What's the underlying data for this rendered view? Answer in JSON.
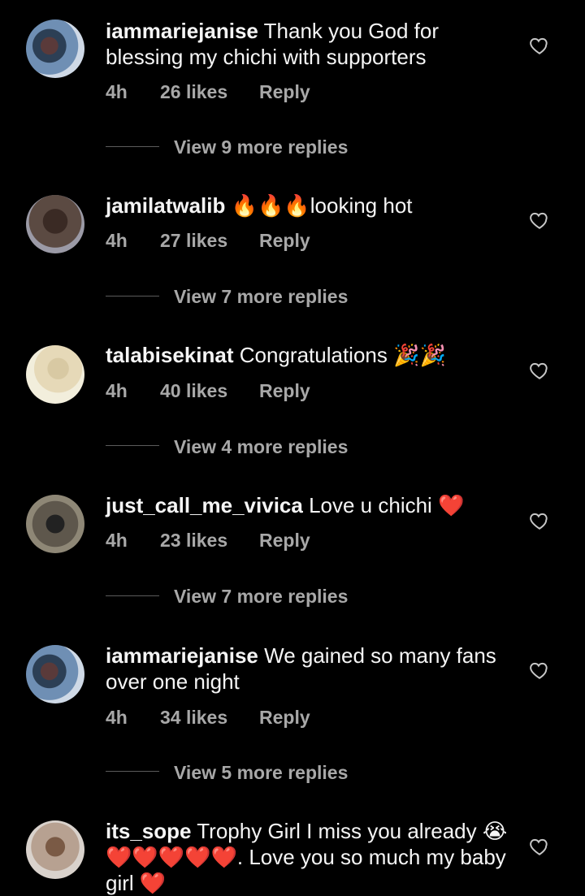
{
  "comments": [
    {
      "username": "iammariejanise",
      "text": "Thank you God for blessing my chichi with supporters",
      "time": "4h",
      "likes": "26 likes",
      "reply": "Reply",
      "more_replies": "View 9 more replies",
      "avatar_icon": "user-avatar"
    },
    {
      "username": "jamilatwalib",
      "text": "🔥🔥🔥looking hot",
      "time": "4h",
      "likes": "27 likes",
      "reply": "Reply",
      "more_replies": "View 7 more replies",
      "avatar_icon": "user-avatar"
    },
    {
      "username": "talabisekinat",
      "text": "Congratulations 🎉🎉",
      "time": "4h",
      "likes": "40 likes",
      "reply": "Reply",
      "more_replies": "View 4 more replies",
      "avatar_icon": "user-avatar"
    },
    {
      "username": "just_call_me_vivica",
      "text": "Love u chichi ❤️",
      "time": "4h",
      "likes": "23 likes",
      "reply": "Reply",
      "more_replies": "View 7 more replies",
      "avatar_icon": "user-avatar"
    },
    {
      "username": "iammariejanise",
      "text": "We gained so many fans over one night",
      "time": "4h",
      "likes": "34 likes",
      "reply": "Reply",
      "more_replies": "View 5 more replies",
      "avatar_icon": "user-avatar"
    },
    {
      "username": "its_sope",
      "text": "Trophy Girl I miss you already 😭❤️❤️❤️❤️❤️. Love you so much my baby girl ❤️",
      "avatar_icon": "user-avatar"
    }
  ],
  "colors": {
    "background": "#000000",
    "primary_text": "#f5f5f5",
    "secondary_text": "#a8a8a8"
  }
}
